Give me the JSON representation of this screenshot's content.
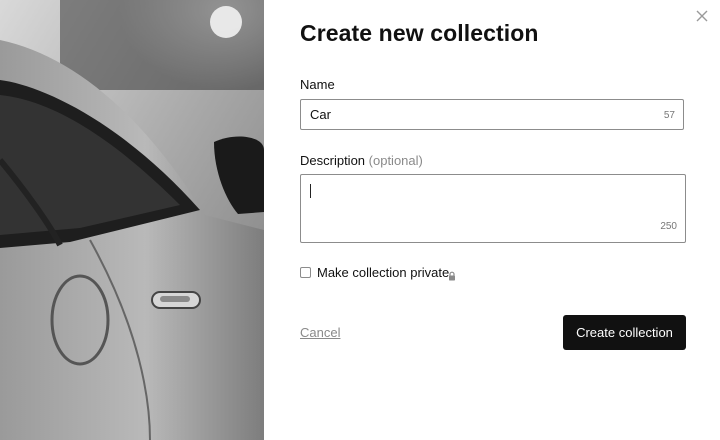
{
  "dialog": {
    "title": "Create new collection",
    "close_icon": "close-icon",
    "photo_icon": "car-photo"
  },
  "name_field": {
    "label": "Name",
    "value": "Car",
    "counter": "57"
  },
  "description_field": {
    "label": "Description",
    "optional_label": "(optional)",
    "value": "",
    "counter": "250"
  },
  "private_option": {
    "label": "Make collection private",
    "checked": false,
    "icon": "lock-icon"
  },
  "actions": {
    "cancel_label": "Cancel",
    "create_label": "Create collection"
  },
  "colors": {
    "primary_button": "#111111",
    "muted_text": "#8a8a8a",
    "border": "#8c8c8c"
  }
}
